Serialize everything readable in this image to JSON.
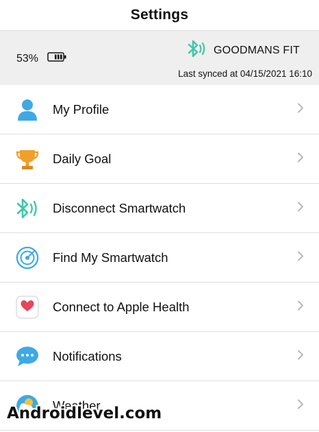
{
  "header": {
    "title": "Settings"
  },
  "status": {
    "battery_text": "53%",
    "battery_level": 0.53,
    "device_name": "GOODMANS FIT",
    "last_synced": "Last synced at 04/15/2021 16:10"
  },
  "menu": [
    {
      "label": "My Profile",
      "icon": "person-icon"
    },
    {
      "label": "Daily Goal",
      "icon": "trophy-icon"
    },
    {
      "label": "Disconnect Smartwatch",
      "icon": "bluetooth-icon"
    },
    {
      "label": "Find My Smartwatch",
      "icon": "radar-icon"
    },
    {
      "label": "Connect to Apple Health",
      "icon": "health-heart-icon"
    },
    {
      "label": "Notifications",
      "icon": "chat-bubble-icon"
    },
    {
      "label": "Weather",
      "icon": "weather-icon"
    }
  ],
  "watermark": "Androidlevel.com",
  "colors": {
    "accent_green": "#3ec6a8",
    "profile_blue": "#3ea9e6",
    "trophy_orange": "#f0a02a",
    "heart_red": "#e8455a"
  }
}
